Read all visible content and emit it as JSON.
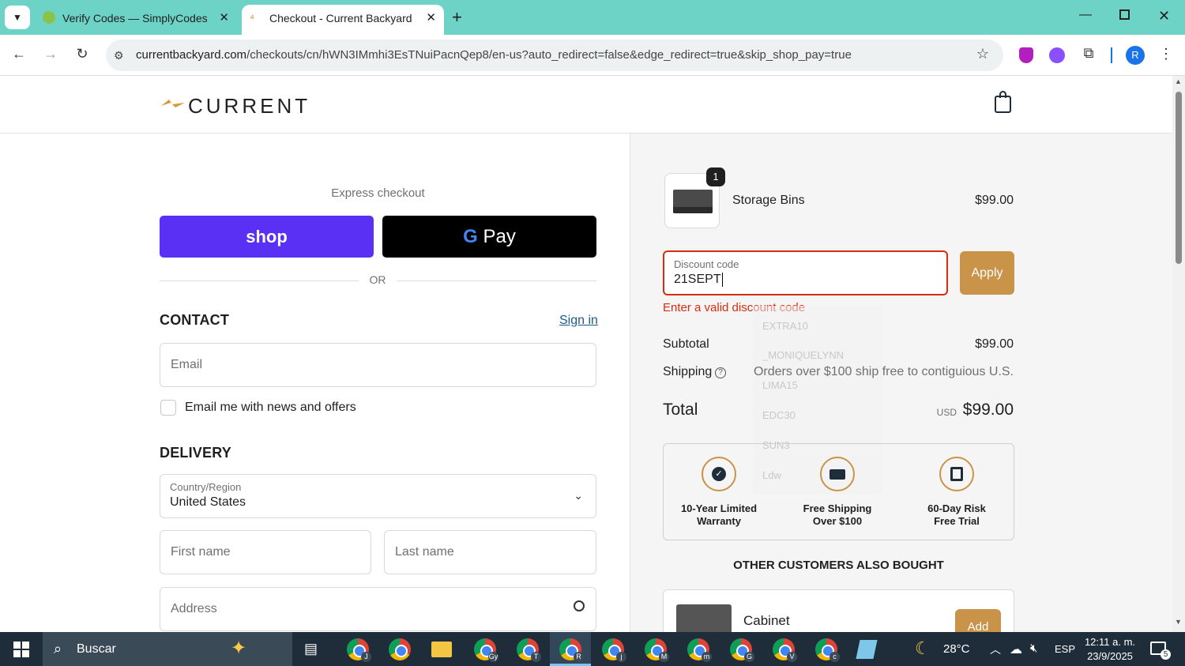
{
  "browser": {
    "tabs": [
      {
        "title": "Verify Codes — SimplyCodes"
      },
      {
        "title": "Checkout - Current Backyard LL"
      }
    ],
    "url_domain": "currentbackyard.com",
    "url_path": "/checkouts/cn/hWN3IMmhi3EsTNuiPacnQep8/en-us?auto_redirect=false&edge_redirect=true&skip_shop_pay=true",
    "profile_initial": "R"
  },
  "header": {
    "logo_text": "CURRENT"
  },
  "checkout": {
    "express_label": "Express checkout",
    "shop_pay_label": "shop",
    "gpay_label": "Pay",
    "or_label": "OR",
    "contact": {
      "heading": "CONTACT",
      "sign_in": "Sign in",
      "email_placeholder": "Email",
      "newsletter_label": "Email me with news and offers"
    },
    "delivery": {
      "heading": "DELIVERY",
      "country_label": "Country/Region",
      "country_value": "United States",
      "first_name_placeholder": "First name",
      "last_name_placeholder": "Last name",
      "address_placeholder": "Address"
    }
  },
  "summary": {
    "item": {
      "name": "Storage Bins",
      "price": "$99.00",
      "quantity": "1"
    },
    "discount": {
      "label": "Discount code",
      "value": "21SEPT",
      "apply_label": "Apply",
      "error": "Enter a valid discount code",
      "error_color": "#d72c0d",
      "suggestions": [
        "EXTRA10",
        "_MONIQUELYNN",
        "LIMA15",
        "EDC30",
        "SUN3",
        "Ldw"
      ]
    },
    "subtotal_label": "Subtotal",
    "subtotal_value": "$99.00",
    "shipping_label": "Shipping",
    "shipping_value": "Orders over $100 ship free to contiguious U.S.",
    "total_label": "Total",
    "total_currency": "USD",
    "total_value": "$99.00",
    "benefits": [
      {
        "line1": "10-Year Limited",
        "line2": "Warranty",
        "icon": "check-circle-icon"
      },
      {
        "line1": "Free Shipping",
        "line2": "Over $100",
        "icon": "truck-icon"
      },
      {
        "line1": "60-Day Risk",
        "line2": "Free Trial",
        "icon": "calendar-icon"
      }
    ],
    "upsell_heading": "OTHER CUSTOMERS ALSO BOUGHT",
    "upsell_item": {
      "name": "Cabinet",
      "add_label": "Add"
    },
    "accent_color": "#c9944a"
  },
  "taskbar": {
    "search_placeholder": "Buscar",
    "weather": "28°C",
    "language": "ESP",
    "time": "12:11 a. m.",
    "date": "23/9/2025",
    "notification_count": "5",
    "chrome_badges": [
      "J",
      "",
      "Gy",
      "T",
      "R",
      "j",
      "M",
      "m",
      "G",
      "V",
      "c"
    ]
  }
}
